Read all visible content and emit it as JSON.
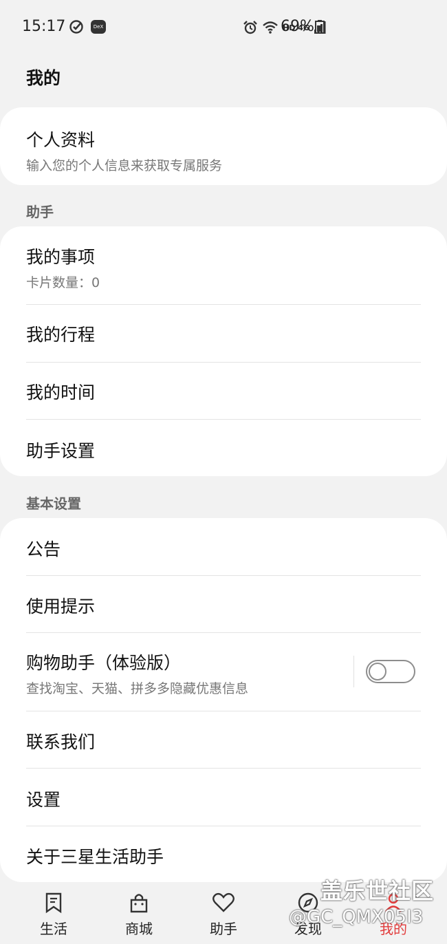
{
  "status_bar": {
    "time": "15:17",
    "battery": "69%",
    "network": "HD 4G",
    "icons": [
      "check-circle-icon",
      "dex-icon",
      "alarm-icon",
      "wifi-icon",
      "signal-icon",
      "battery-icon"
    ]
  },
  "header": {
    "title": "我的"
  },
  "profile": {
    "title": "个人资料",
    "subtitle": "输入您的个人信息来获取专属服务"
  },
  "assistant_section": {
    "label": "助手",
    "items": [
      {
        "title": "我的事项",
        "subtitle": "卡片数量：0"
      },
      {
        "title": "我的行程"
      },
      {
        "title": "我的时间"
      },
      {
        "title": "助手设置"
      }
    ]
  },
  "basic_section": {
    "label": "基本设置",
    "items": [
      {
        "title": "公告"
      },
      {
        "title": "使用提示"
      },
      {
        "title": "购物助手（体验版）",
        "subtitle": "查找淘宝、天猫、拼多多隐藏优惠信息",
        "toggle": false
      },
      {
        "title": "联系我们"
      },
      {
        "title": "设置"
      },
      {
        "title": "关于三星生活助手"
      }
    ]
  },
  "bottom_nav": {
    "items": [
      {
        "label": "生活",
        "icon": "bookmark-icon"
      },
      {
        "label": "商城",
        "icon": "shopping-bag-icon"
      },
      {
        "label": "助手",
        "icon": "heart-icon"
      },
      {
        "label": "发现",
        "icon": "compass-icon"
      },
      {
        "label": "我的",
        "icon": "person-icon",
        "active": true
      }
    ],
    "active_color": "#e23c3c"
  },
  "watermark": {
    "text": "盖乐世社区",
    "id": "@GC_QMX05I3"
  }
}
